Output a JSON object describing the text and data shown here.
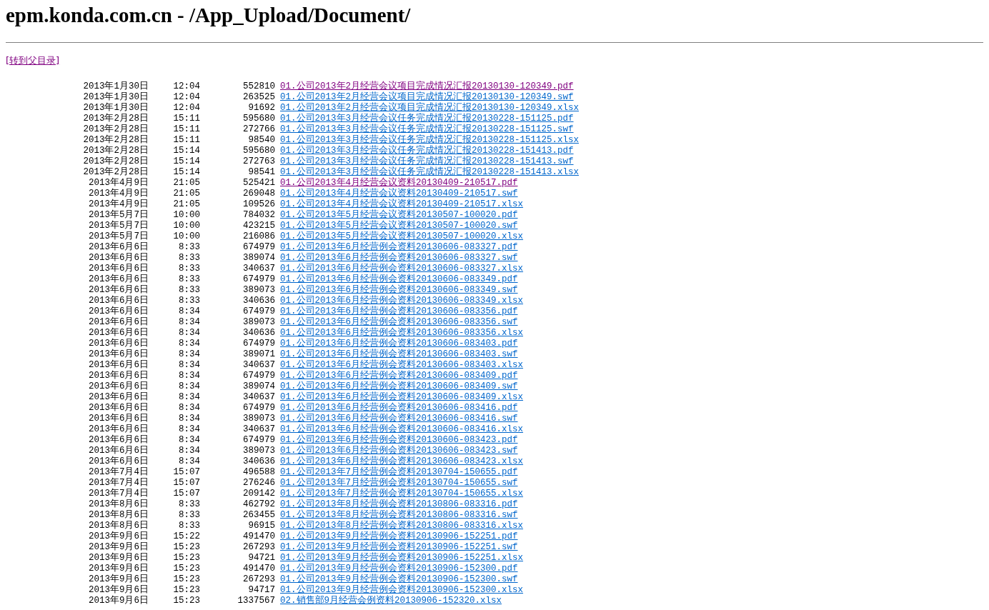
{
  "title": "epm.konda.com.cn - /App_Upload/Document/",
  "parent_link": {
    "label": "[转到父目录]",
    "visited": true
  },
  "files": [
    {
      "date": "2013年1月30日",
      "time": "12:04",
      "size": "552810",
      "name": "01.公司2013年2月经营会议项目完成情况汇报20130130-120349.pdf",
      "visited": true
    },
    {
      "date": "2013年1月30日",
      "time": "12:04",
      "size": "263525",
      "name": "01.公司2013年2月经营会议项目完成情况汇报20130130-120349.swf",
      "visited": false
    },
    {
      "date": "2013年1月30日",
      "time": "12:04",
      "size": "91692",
      "name": "01.公司2013年2月经营会议项目完成情况汇报20130130-120349.xlsx",
      "visited": false
    },
    {
      "date": "2013年2月28日",
      "time": "15:11",
      "size": "595680",
      "name": "01.公司2013年3月经营会议任务完成情况汇报20130228-151125.pdf",
      "visited": false
    },
    {
      "date": "2013年2月28日",
      "time": "15:11",
      "size": "272766",
      "name": "01.公司2013年3月经营会议任务完成情况汇报20130228-151125.swf",
      "visited": false
    },
    {
      "date": "2013年2月28日",
      "time": "15:11",
      "size": "98540",
      "name": "01.公司2013年3月经营会议任务完成情况汇报20130228-151125.xlsx",
      "visited": false
    },
    {
      "date": "2013年2月28日",
      "time": "15:14",
      "size": "595680",
      "name": "01.公司2013年3月经营会议任务完成情况汇报20130228-151413.pdf",
      "visited": false
    },
    {
      "date": "2013年2月28日",
      "time": "15:14",
      "size": "272763",
      "name": "01.公司2013年3月经营会议任务完成情况汇报20130228-151413.swf",
      "visited": false
    },
    {
      "date": "2013年2月28日",
      "time": "15:14",
      "size": "98541",
      "name": "01.公司2013年3月经营会议任务完成情况汇报20130228-151413.xlsx",
      "visited": false
    },
    {
      "date": "2013年4月9日",
      "time": "21:05",
      "size": "525421",
      "name": "01.公司2013年4月经营会议资料20130409-210517.pdf",
      "visited": true
    },
    {
      "date": "2013年4月9日",
      "time": "21:05",
      "size": "269048",
      "name": "01.公司2013年4月经营会议资料20130409-210517.swf",
      "visited": false
    },
    {
      "date": "2013年4月9日",
      "time": "21:05",
      "size": "109526",
      "name": "01.公司2013年4月经营会议资料20130409-210517.xlsx",
      "visited": false
    },
    {
      "date": "2013年5月7日",
      "time": "10:00",
      "size": "784032",
      "name": "01.公司2013年5月经营会议资料20130507-100020.pdf",
      "visited": false
    },
    {
      "date": "2013年5月7日",
      "time": "10:00",
      "size": "423215",
      "name": "01.公司2013年5月经营会议资料20130507-100020.swf",
      "visited": false
    },
    {
      "date": "2013年5月7日",
      "time": "10:00",
      "size": "216086",
      "name": "01.公司2013年5月经营会议资料20130507-100020.xlsx",
      "visited": false
    },
    {
      "date": "2013年6月6日",
      "time": "8:33",
      "size": "674979",
      "name": "01.公司2013年6月经营例会资料20130606-083327.pdf",
      "visited": false
    },
    {
      "date": "2013年6月6日",
      "time": "8:33",
      "size": "389074",
      "name": "01.公司2013年6月经营例会资料20130606-083327.swf",
      "visited": false
    },
    {
      "date": "2013年6月6日",
      "time": "8:33",
      "size": "340637",
      "name": "01.公司2013年6月经营例会资料20130606-083327.xlsx",
      "visited": false
    },
    {
      "date": "2013年6月6日",
      "time": "8:33",
      "size": "674979",
      "name": "01.公司2013年6月经营例会资料20130606-083349.pdf",
      "visited": false
    },
    {
      "date": "2013年6月6日",
      "time": "8:33",
      "size": "389073",
      "name": "01.公司2013年6月经营例会资料20130606-083349.swf",
      "visited": false
    },
    {
      "date": "2013年6月6日",
      "time": "8:33",
      "size": "340636",
      "name": "01.公司2013年6月经营例会资料20130606-083349.xlsx",
      "visited": false
    },
    {
      "date": "2013年6月6日",
      "time": "8:34",
      "size": "674979",
      "name": "01.公司2013年6月经营例会资料20130606-083356.pdf",
      "visited": false
    },
    {
      "date": "2013年6月6日",
      "time": "8:34",
      "size": "389073",
      "name": "01.公司2013年6月经营例会资料20130606-083356.swf",
      "visited": false
    },
    {
      "date": "2013年6月6日",
      "time": "8:34",
      "size": "340636",
      "name": "01.公司2013年6月经营例会资料20130606-083356.xlsx",
      "visited": false
    },
    {
      "date": "2013年6月6日",
      "time": "8:34",
      "size": "674979",
      "name": "01.公司2013年6月经营例会资料20130606-083403.pdf",
      "visited": false
    },
    {
      "date": "2013年6月6日",
      "time": "8:34",
      "size": "389071",
      "name": "01.公司2013年6月经营例会资料20130606-083403.swf",
      "visited": false
    },
    {
      "date": "2013年6月6日",
      "time": "8:34",
      "size": "340637",
      "name": "01.公司2013年6月经营例会资料20130606-083403.xlsx",
      "visited": false
    },
    {
      "date": "2013年6月6日",
      "time": "8:34",
      "size": "674979",
      "name": "01.公司2013年6月经营例会资料20130606-083409.pdf",
      "visited": false
    },
    {
      "date": "2013年6月6日",
      "time": "8:34",
      "size": "389074",
      "name": "01.公司2013年6月经营例会资料20130606-083409.swf",
      "visited": false
    },
    {
      "date": "2013年6月6日",
      "time": "8:34",
      "size": "340637",
      "name": "01.公司2013年6月经营例会资料20130606-083409.xlsx",
      "visited": false
    },
    {
      "date": "2013年6月6日",
      "time": "8:34",
      "size": "674979",
      "name": "01.公司2013年6月经营例会资料20130606-083416.pdf",
      "visited": false
    },
    {
      "date": "2013年6月6日",
      "time": "8:34",
      "size": "389073",
      "name": "01.公司2013年6月经营例会资料20130606-083416.swf",
      "visited": false
    },
    {
      "date": "2013年6月6日",
      "time": "8:34",
      "size": "340637",
      "name": "01.公司2013年6月经营例会资料20130606-083416.xlsx",
      "visited": false
    },
    {
      "date": "2013年6月6日",
      "time": "8:34",
      "size": "674979",
      "name": "01.公司2013年6月经营例会资料20130606-083423.pdf",
      "visited": false
    },
    {
      "date": "2013年6月6日",
      "time": "8:34",
      "size": "389073",
      "name": "01.公司2013年6月经营例会资料20130606-083423.swf",
      "visited": false
    },
    {
      "date": "2013年6月6日",
      "time": "8:34",
      "size": "340636",
      "name": "01.公司2013年6月经营例会资料20130606-083423.xlsx",
      "visited": false
    },
    {
      "date": "2013年7月4日",
      "time": "15:07",
      "size": "496588",
      "name": "01.公司2013年7月经营例会资料20130704-150655.pdf",
      "visited": false
    },
    {
      "date": "2013年7月4日",
      "time": "15:07",
      "size": "276246",
      "name": "01.公司2013年7月经营例会资料20130704-150655.swf",
      "visited": false
    },
    {
      "date": "2013年7月4日",
      "time": "15:07",
      "size": "209142",
      "name": "01.公司2013年7月经营例会资料20130704-150655.xlsx",
      "visited": false
    },
    {
      "date": "2013年8月6日",
      "time": "8:33",
      "size": "462792",
      "name": "01.公司2013年8月经营例会资料20130806-083316.pdf",
      "visited": false
    },
    {
      "date": "2013年8月6日",
      "time": "8:33",
      "size": "263455",
      "name": "01.公司2013年8月经营例会资料20130806-083316.swf",
      "visited": false
    },
    {
      "date": "2013年8月6日",
      "time": "8:33",
      "size": "96915",
      "name": "01.公司2013年8月经营例会资料20130806-083316.xlsx",
      "visited": false
    },
    {
      "date": "2013年9月6日",
      "time": "15:22",
      "size": "491470",
      "name": "01.公司2013年9月经营例会资料20130906-152251.pdf",
      "visited": false
    },
    {
      "date": "2013年9月6日",
      "time": "15:23",
      "size": "267293",
      "name": "01.公司2013年9月经营例会资料20130906-152251.swf",
      "visited": false
    },
    {
      "date": "2013年9月6日",
      "time": "15:23",
      "size": "94721",
      "name": "01.公司2013年9月经营例会资料20130906-152251.xlsx",
      "visited": false
    },
    {
      "date": "2013年9月6日",
      "time": "15:23",
      "size": "491470",
      "name": "01.公司2013年9月经营例会资料20130906-152300.pdf",
      "visited": false
    },
    {
      "date": "2013年9月6日",
      "time": "15:23",
      "size": "267293",
      "name": "01.公司2013年9月经营例会资料20130906-152300.swf",
      "visited": false
    },
    {
      "date": "2013年9月6日",
      "time": "15:23",
      "size": "94717",
      "name": "01.公司2013年9月经营例会资料20130906-152300.xlsx",
      "visited": false
    },
    {
      "date": "2013年9月6日",
      "time": "15:23",
      "size": "1337567",
      "name": "02.销售部9月经营会例资料20130906-152320.xlsx",
      "visited": false
    }
  ]
}
